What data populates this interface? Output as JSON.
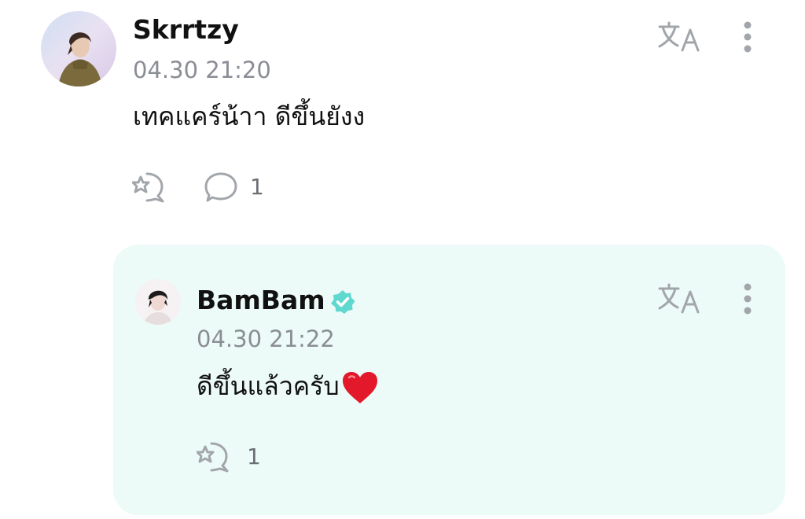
{
  "comment": {
    "username": "Skrrtzy",
    "timestamp": "04.30 21:20",
    "text": "เทคแคร์น้าา ดีขึ้นยังง",
    "reply_count": "1",
    "icons": [
      "translate-icon",
      "more-icon",
      "cheer-icon",
      "reply-icon"
    ]
  },
  "reply": {
    "username": "BamBam",
    "verified": true,
    "timestamp": "04.30 21:22",
    "text": "ดีขึ้นแล้วครับ",
    "emoji": "❤️",
    "cheer_count": "1",
    "icons": [
      "translate-icon",
      "more-icon",
      "verified-badge-icon",
      "cheer-icon"
    ]
  },
  "colors": {
    "reply_background": "#ecfbf8",
    "verified": "#5fd8cf",
    "icon_gray": "#a2a6ab",
    "timestamp_gray": "#8a8e94"
  }
}
